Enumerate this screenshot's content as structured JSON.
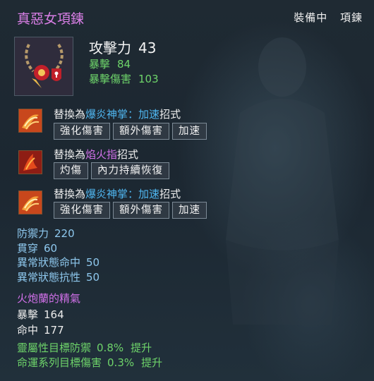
{
  "item": {
    "name": "真惡女項鍊",
    "status": "裝備中",
    "type": "項鍊",
    "icon": "necklace-icon",
    "attack_label": "攻擊力",
    "attack_value": "43",
    "crit_label": "暴擊",
    "crit_value": "84",
    "crit_dmg_label": "暴擊傷害",
    "crit_dmg_value": "103"
  },
  "skills": [
    {
      "icon": "flame-palm-icon",
      "prefix": "替換為",
      "name": "爆炎神掌",
      "sep": "：",
      "variant": "加速",
      "suffix": "招式",
      "tags": [
        "強化傷害",
        "額外傷害",
        "加速"
      ]
    },
    {
      "icon": "flame-finger-icon",
      "prefix": "替換為",
      "name": "焰火指",
      "suffix": "招式",
      "tags": [
        "灼傷",
        "內力持續恢復"
      ]
    },
    {
      "icon": "flame-palm-icon",
      "prefix": "替換為",
      "name": "爆炎神掌",
      "sep": "：",
      "variant": "加速",
      "suffix": "招式",
      "tags": [
        "強化傷害",
        "額外傷害",
        "加速"
      ]
    }
  ],
  "stats": [
    {
      "label": "防禦力",
      "value": "220"
    },
    {
      "label": "貫穿",
      "value": "60"
    },
    {
      "label": "異常狀態命中",
      "value": "50"
    },
    {
      "label": "異常狀態抗性",
      "value": "50"
    }
  ],
  "soul": {
    "title": "火炮蘭的精氣",
    "stats": [
      {
        "label": "暴擊",
        "value": "164"
      },
      {
        "label": "命中",
        "value": "177"
      }
    ]
  },
  "bonuses": [
    {
      "label": "靈屬性目標防禦",
      "value": "0.8%",
      "suffix": "提升"
    },
    {
      "label": "命運系列目標傷害",
      "value": "0.3%",
      "suffix": "提升"
    }
  ],
  "colors": {
    "title": "#d97fe6",
    "green": "#6ed46a",
    "blue": "#4fb6f0",
    "purple": "#d070e8",
    "stat": "#8ec8ee"
  }
}
